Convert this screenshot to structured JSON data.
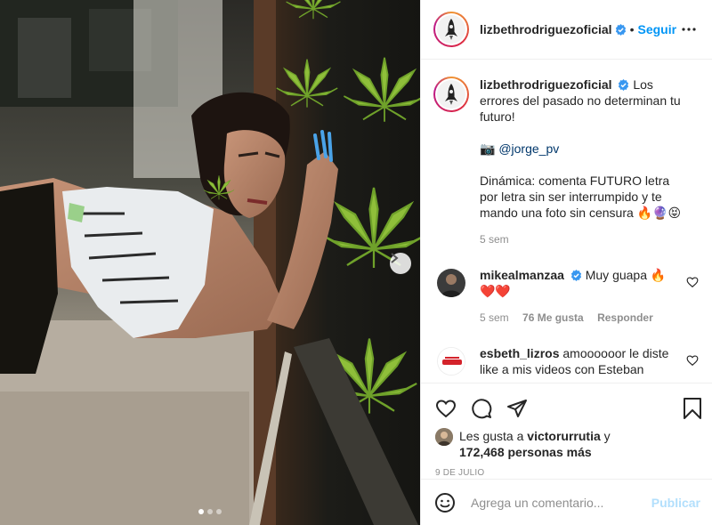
{
  "post": {
    "author": "lizbethrodriguezoficial",
    "follow_separator": "•",
    "follow_label": "Seguir",
    "caption_lines": {
      "intro": "Los errores del pasado no determinan tu futuro!",
      "credit_prefix": "📷",
      "credit_mention": "@jorge_pv",
      "dynamic": "Dinámica: comenta FUTURO letra por letra sin ser interrumpido y te mando una foto sin censura 🔥🔮😝"
    },
    "caption_age": "5 sem",
    "carousel": {
      "total": 3,
      "active": 0
    }
  },
  "comments": [
    {
      "username": "mikealmanzaa",
      "verified": true,
      "text": "Muy guapa 🔥❤️❤️",
      "age": "5 sem",
      "likes": "76 Me gusta",
      "reply": "Responder"
    },
    {
      "username": "esbeth_lizros",
      "verified": false,
      "text": "amoooooor le diste like a mis videos con Esteban"
    }
  ],
  "likes_summary": {
    "prefix": "Les gusta a",
    "user": "victorurrutia",
    "suffix": "y",
    "count_text": "172,468 personas más"
  },
  "date": "9 DE JULIO",
  "composer": {
    "placeholder": "Agrega un comentario...",
    "publish_label": "Publicar"
  },
  "colors": {
    "accent": "#0095f6",
    "publish_disabled": "#b2dffc",
    "muted": "#8e8e8e",
    "text": "#262626",
    "verified": "#3897f0"
  }
}
